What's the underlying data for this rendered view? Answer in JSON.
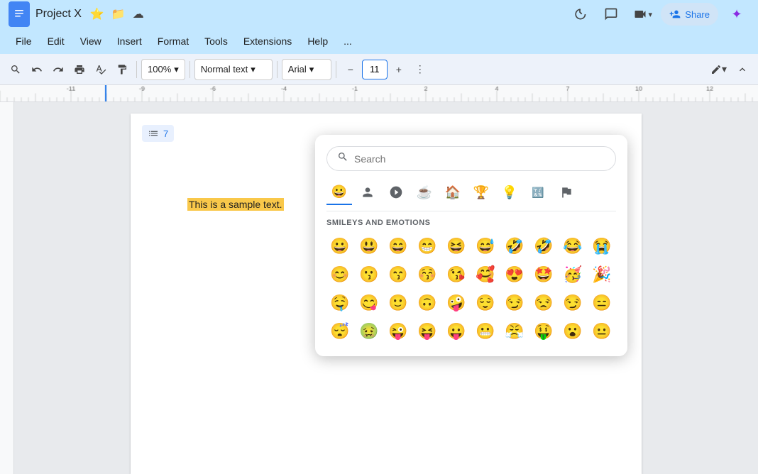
{
  "title_bar": {
    "app_name": "Project X",
    "bookmark_icon": "⭐",
    "history_icon": "📁",
    "cloud_icon": "☁",
    "history_btn": "🕐",
    "comment_btn": "💬",
    "videocam_btn": "📹",
    "adduser_btn": "👤+",
    "gemini_btn": "✦"
  },
  "menu": {
    "items": [
      "File",
      "Edit",
      "View",
      "Insert",
      "Format",
      "Tools",
      "Extensions",
      "Help",
      "..."
    ]
  },
  "toolbar": {
    "zoom": "100%",
    "text_style": "Normal text",
    "font": "Arial",
    "font_size": "11",
    "more_icon": "⋮",
    "paint_icon": "🖌",
    "chevron": "▾",
    "minus_icon": "−",
    "plus_icon": "+"
  },
  "document": {
    "list_number": "7",
    "sample_text": "This is a sample text."
  },
  "emoji_picker": {
    "search_placeholder": "Search",
    "category_label": "SMILEYS AND EMOTIONS",
    "categories": [
      {
        "name": "smileys",
        "icon": "😀"
      },
      {
        "name": "people",
        "icon": "🧍"
      },
      {
        "name": "activities",
        "icon": "🎮"
      },
      {
        "name": "food",
        "icon": "☕"
      },
      {
        "name": "travel",
        "icon": "🏠"
      },
      {
        "name": "objects",
        "icon": "🏆"
      },
      {
        "name": "symbols",
        "icon": "💡"
      },
      {
        "name": "special",
        "icon": "🔣"
      },
      {
        "name": "flags",
        "icon": "🏴"
      }
    ],
    "emojis_row1": [
      "😀",
      "😃",
      "😄",
      "😁",
      "😆",
      "😅",
      "🤣",
      "🤣",
      "😂",
      "😭"
    ],
    "emojis_row2": [
      "😊",
      "😗",
      "😙",
      "😚",
      "😘",
      "🥰",
      "😍",
      "🤩",
      "🥳",
      "🎉"
    ],
    "emojis_row3": [
      "🤤",
      "😋",
      "🙂",
      "🙃",
      "🤪",
      "😌",
      "😏",
      "😒",
      "😏",
      "😑"
    ],
    "emojis_row4": [
      "😴",
      "🤢",
      "😜",
      "😝",
      "😛",
      "😬",
      "😤",
      "🤑",
      "😮",
      "😐"
    ]
  }
}
